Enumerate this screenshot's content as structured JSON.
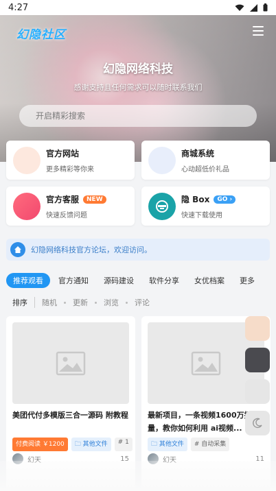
{
  "status_bar": {
    "time": "4:27"
  },
  "header": {
    "logo_text": "幻隐社区",
    "site_title": "幻隐网络科技",
    "subtitle": "感谢支持且任何需求可以随时联系我们",
    "search_placeholder": "开启精彩搜索"
  },
  "quick_links": [
    {
      "title": "官方网站",
      "desc": "更多精彩等你来",
      "icon": "globe-icon",
      "color": "#fde8de"
    },
    {
      "title": "商城系统",
      "desc": "心动超低价礼品",
      "icon": "cart-icon",
      "color": "#e8eefb"
    },
    {
      "title": "官方客服",
      "badge": "NEW",
      "desc": "快速反馈问题",
      "icon": "headset-icon",
      "color": "#f2496f"
    },
    {
      "title": "隐 Box",
      "badge": "GO",
      "desc": "快速下载使用",
      "icon": "box-icon",
      "color": "#1aa3a8"
    }
  ],
  "notice": {
    "text": "幻隐网络科技官方论坛，欢迎访问。"
  },
  "tabs": [
    "推荐观看",
    "官方通知",
    "源码建设",
    "软件分享",
    "女优档案",
    "更多"
  ],
  "sort": {
    "label": "排序",
    "options": [
      "随机",
      "更新",
      "浏览",
      "评论"
    ]
  },
  "posts": [
    {
      "title": "美团代付多模版三合一源码 附教程",
      "tags": [
        "付费阅读 ￥1200",
        "其他文件",
        "# 1"
      ],
      "author": "幻天",
      "count": "15"
    },
    {
      "title": "最新项目，一条视频1600万播放量，教你如何利用 ai视频...",
      "tags": [
        "其他文件",
        "# 自动采集"
      ],
      "author": "幻天",
      "count": "11"
    }
  ],
  "colors": {
    "accent": "#2196f3",
    "pay": "#ff7a33",
    "notice_bg": "#e5eefb"
  }
}
